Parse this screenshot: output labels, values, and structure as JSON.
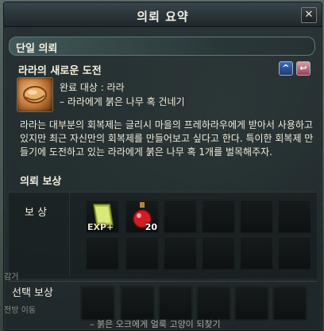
{
  "window": {
    "title": "의뢰 요약",
    "close_label": "✕"
  },
  "section_single": {
    "label": "단일 의뢰"
  },
  "quest": {
    "title": "라라의 새로운 도전",
    "completion_target": "완료 대상 : 라라",
    "objective": "– 라라에게 붉은 나무 혹 건네기",
    "description": "라라는 대부분의 회복제는 글리시 마을의 프레하라우에게 받아서 사용하고 있지만 최근 자신만의 회복제를 만들어보고 싶다고 한다. 특이한 회복제 만들기에 도전하고 있는 라라에게 붉은 나무 혹 1개를 벌목해주자."
  },
  "rewards": {
    "title": "의뢰 보상",
    "basic_label": "보 상",
    "choice_label": "선택 보상",
    "basic_items": [
      {
        "icon": "exp-scroll-icon",
        "text": "EXP+"
      },
      {
        "icon": "red-potion-icon",
        "count": "20"
      }
    ]
  },
  "background": {
    "left_text_1": "감거",
    "left_text_2": "전방 이동",
    "bottom_text": "– 붉은 오크에게 얼룩 고양이 되찾기"
  },
  "colors": {
    "accent_blue": "#3f6eb9",
    "accent_red": "#9a4050"
  }
}
